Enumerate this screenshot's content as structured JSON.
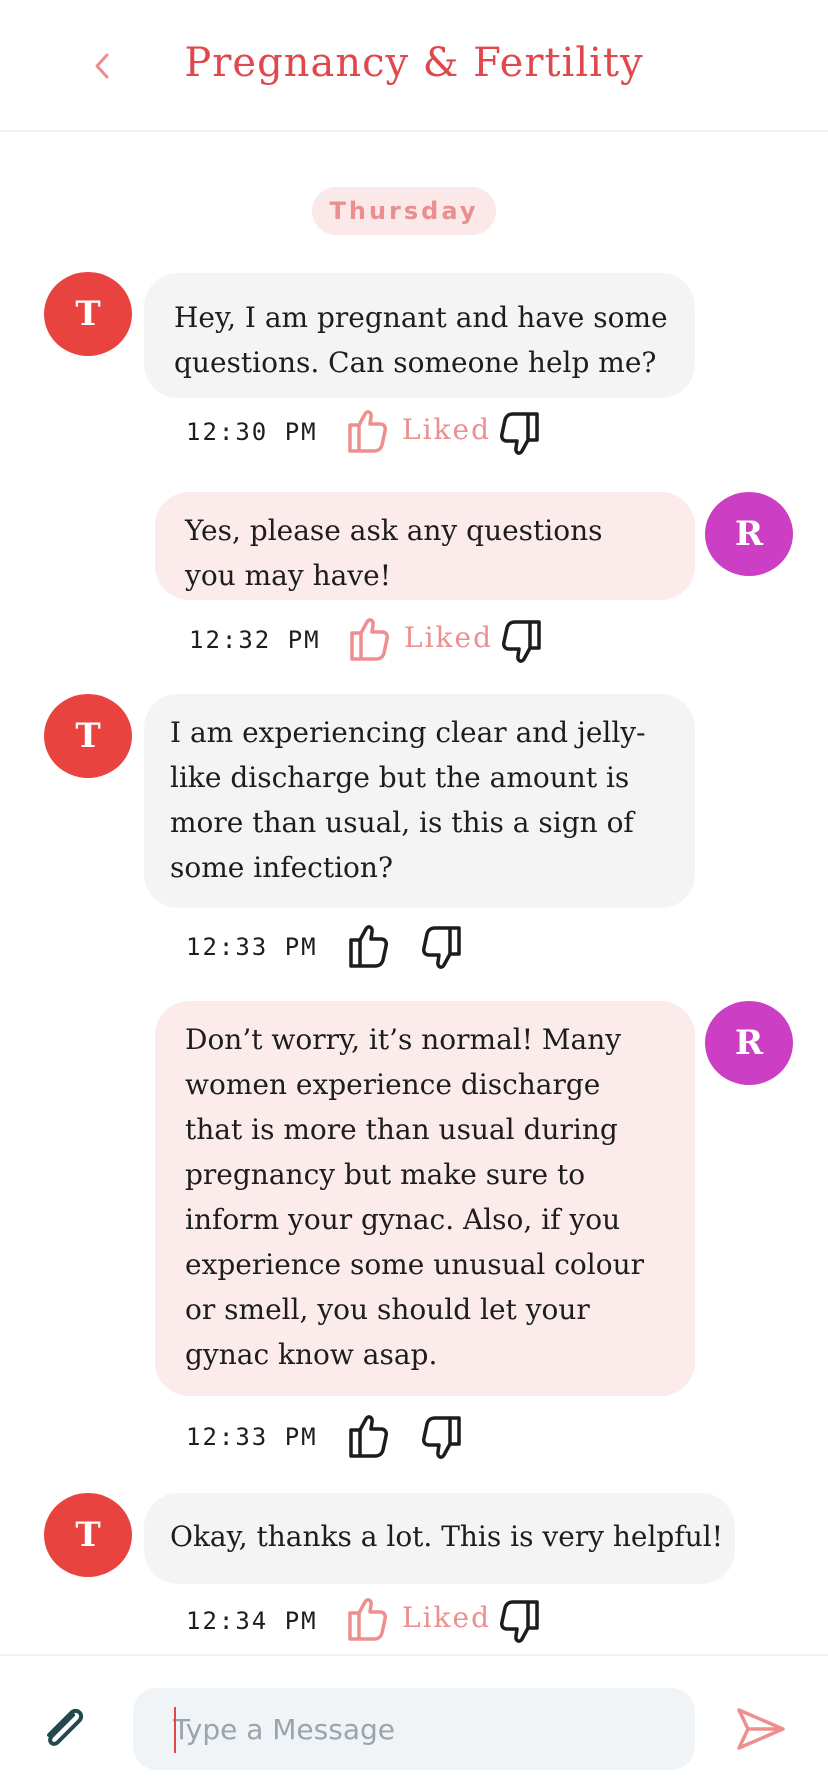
{
  "header": {
    "title": "Pregnancy & Fertility",
    "back_icon": "chevron-left-icon"
  },
  "day_separator": "Thursday",
  "colors": {
    "accent": "#e0484c",
    "avatar_t": "#e8433f",
    "avatar_r": "#cc3fc4",
    "incoming_bubble": "#f4f4f5",
    "outgoing_bubble": "#fbeceb",
    "liked": "#ed8f8f"
  },
  "messages": [
    {
      "sender": "T",
      "text": "Hey, I am pregnant and have some\nquestions. Can someone help me?",
      "time": "12:30 PM",
      "liked": true,
      "liked_label": "Liked"
    },
    {
      "sender": "R",
      "text": "Yes, please ask any questions\nyou may have!",
      "time": "12:32 PM",
      "liked": true,
      "liked_label": "Liked"
    },
    {
      "sender": "T",
      "text": "I am experiencing clear and jelly-\nlike discharge but the amount is\nmore than usual, is this a sign of\nsome infection?",
      "time": "12:33 PM",
      "liked": false
    },
    {
      "sender": "R",
      "text": "Don’t worry, it’s normal! Many\nwomen experience discharge\nthat is more than usual during\npregnancy but make sure to\ninform your gynac. Also, if you\nexperience some unusual colour\nor smell, you should let your\ngynac know asap.",
      "time": "12:33 PM",
      "liked": false
    },
    {
      "sender": "T",
      "text": "Okay, thanks a lot. This is very helpful!",
      "time": "12:34 PM",
      "liked": true,
      "liked_label": "Liked"
    }
  ],
  "composer": {
    "placeholder": "Type a Message",
    "value": "",
    "attach_icon": "paperclip-icon",
    "send_icon": "send-icon"
  }
}
